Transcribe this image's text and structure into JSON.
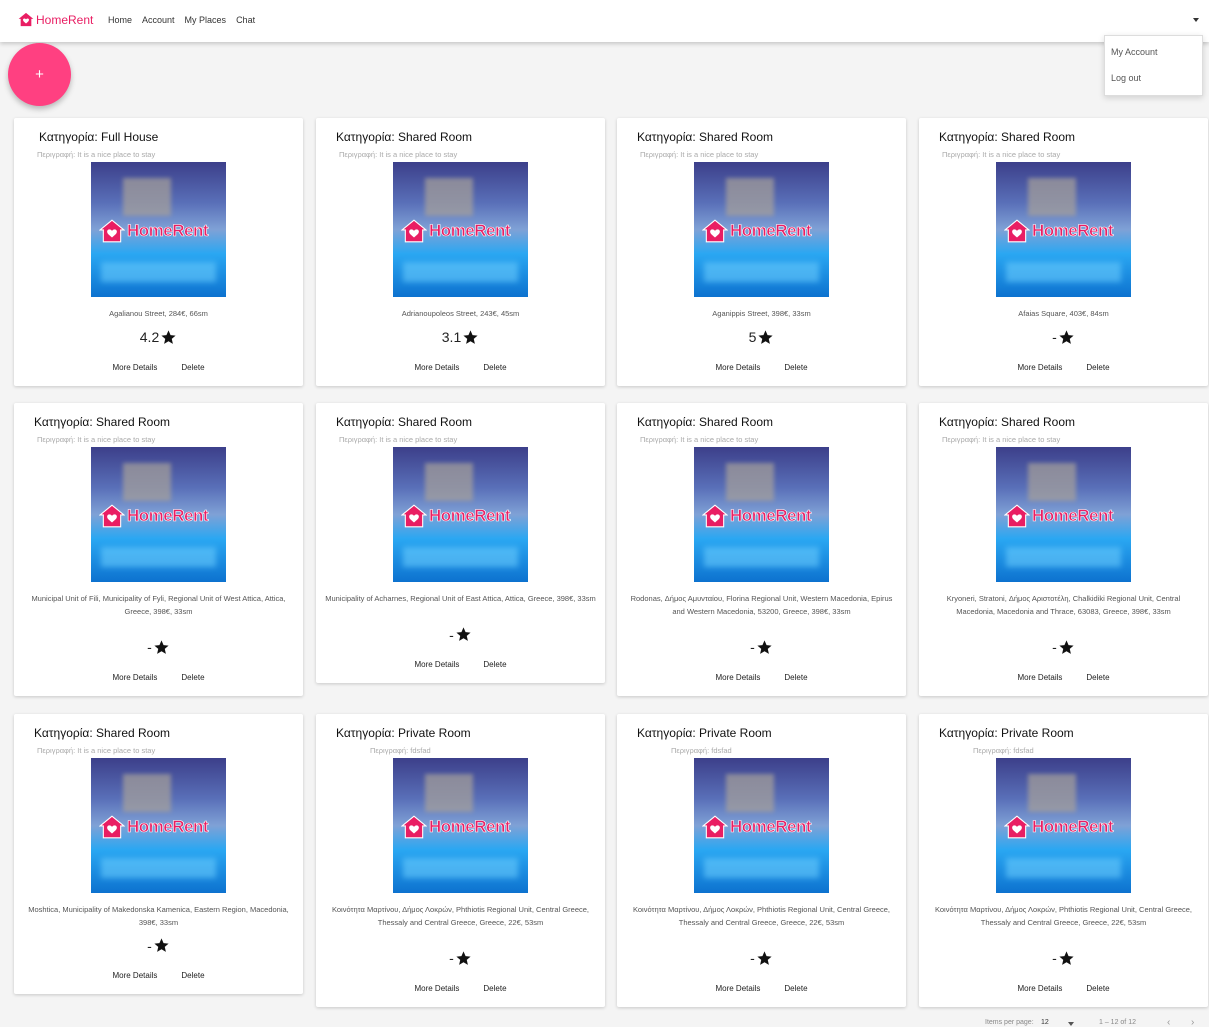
{
  "header": {
    "brand": "HomeRent",
    "nav": [
      "Home",
      "Account",
      "My Places",
      "Chat"
    ]
  },
  "menu": {
    "items": [
      "My Account",
      "Log out"
    ]
  },
  "fab": {
    "label": "+"
  },
  "cards": [
    {
      "category": "Κατηγορία: Full House",
      "description": "Περιγραφή: It is a nice place to stay",
      "address": "Agalianou Street, 284€, 66sm",
      "rating": "4.2"
    },
    {
      "category": "Κατηγορία: Shared Room",
      "description": "Περιγραφή: It is a nice place to stay",
      "address": "Adrianoupoleos Street, 243€, 45sm",
      "rating": "3.1"
    },
    {
      "category": "Κατηγορία: Shared Room",
      "description": "Περιγραφή: It is a nice place to stay",
      "address": "Aganippis Street, 398€, 33sm",
      "rating": "5"
    },
    {
      "category": "Κατηγορία: Shared Room",
      "description": "Περιγραφή: It is a nice place to stay",
      "address": "Afaias Square, 403€, 84sm",
      "rating": "-"
    },
    {
      "category": "Κατηγορία: Shared Room",
      "description": "Περιγραφή: It is a nice place to stay",
      "address": "Municipal Unit of Fili, Municipality of Fyli, Regional Unit of West Attica, Attica, Greece, 398€, 33sm",
      "rating": "-"
    },
    {
      "category": "Κατηγορία: Shared Room",
      "description": "Περιγραφή: It is a nice place to stay",
      "address": "Municipality of Acharnes, Regional Unit of East Attica, Attica, Greece, 398€, 33sm",
      "rating": "-"
    },
    {
      "category": "Κατηγορία: Shared Room",
      "description": "Περιγραφή: It is a nice place to stay",
      "address": "Rodonas, Δήμος Αμυνταίου, Florina Regional Unit, Western Macedonia, Epirus and Western Macedonia, 53200, Greece, 398€, 33sm",
      "rating": "-"
    },
    {
      "category": "Κατηγορία: Shared Room",
      "description": "Περιγραφή: It is a nice place to stay",
      "address": "Kryoneri, Stratoni, Δήμος Αριστοτέλη, Chalkidiki Regional Unit, Central Macedonia, Macedonia and Thrace, 63083, Greece, 398€, 33sm",
      "rating": "-"
    },
    {
      "category": "Κατηγορία: Shared Room",
      "description": "Περιγραφή: It is a nice place to stay",
      "address": "Moshtica, Municipality of Makedonska Kamenica, Eastern Region, Macedonia, 398€, 33sm",
      "rating": "-"
    },
    {
      "category": "Κατηγορία: Private Room",
      "description": "Περιγραφή: fdsfad",
      "address": "Κοινότητα Μαρτίνου, Δήμος Λοκρών, Phthiotis Regional Unit, Central Greece, Thessaly and Central Greece, Greece, 22€, 53sm",
      "rating": "-"
    },
    {
      "category": "Κατηγορία: Private Room",
      "description": "Περιγραφή: fdsfad",
      "address": "Κοινότητα Μαρτίνου, Δήμος Λοκρών, Phthiotis Regional Unit, Central Greece, Thessaly and Central Greece, Greece, 22€, 53sm",
      "rating": "-"
    },
    {
      "category": "Κατηγορία: Private Room",
      "description": "Περιγραφή: fdsfad",
      "address": "Κοινότητα Μαρτίνου, Δήμος Λοκρών, Phthiotis Regional Unit, Central Greece, Thessaly and Central Greece, Greece, 22€, 53sm",
      "rating": "-"
    }
  ],
  "thumb_brand": "HomeRent",
  "actions": {
    "more_details": "More Details",
    "delete": "Delete"
  },
  "paginator": {
    "items_per_page_label": "Items per page:",
    "page_size": "12",
    "range": "1 – 12 of 12",
    "prev": "‹",
    "next": "›"
  },
  "colors": {
    "brand": "#e91e63",
    "fab": "#ff4081"
  }
}
